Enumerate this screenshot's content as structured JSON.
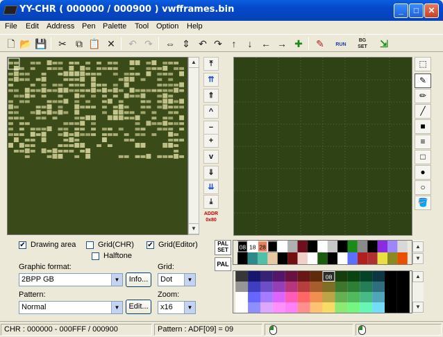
{
  "window": {
    "title": "YY-CHR ( 000000 / 000900 ) vwfframes.bin",
    "minimize": "_",
    "maximize": "□",
    "close": "✕"
  },
  "menu": [
    "File",
    "Edit",
    "Address",
    "Pen",
    "Palette",
    "Tool",
    "Option",
    "Help"
  ],
  "toolbar": {
    "new": "🗋",
    "open": "📂",
    "save": "💾",
    "cut": "✂",
    "copy": "⧉",
    "paste": "📋",
    "delete": "✕",
    "undo": "↶",
    "redo": "↷",
    "flip_h": "⇔",
    "flip_v": "⇕",
    "rot_left": "↶",
    "rot_right": "↷",
    "shift_up": "↑",
    "shift_down": "↓",
    "shift_left": "←",
    "shift_right": "→",
    "replace_color": "✚",
    "edit_icon": "✎",
    "run_label": "RUN",
    "bgset_label": "BG SET",
    "exit_icon": "⇲"
  },
  "nav": {
    "top": "⤒",
    "page_up_fast": "⇈",
    "page_up": "⇑",
    "row_up": "^",
    "line_up": "−",
    "line_down": "+",
    "row_down": "v",
    "page_down": "⇓",
    "page_down_fast": "⇊",
    "bottom": "⤓",
    "addr_label": "ADDR\n0x80"
  },
  "tools": {
    "select": "⬚",
    "pen": "✎",
    "pen2": "✏",
    "line": "╱",
    "rect_fill": "■",
    "stripes": "≡",
    "rect": "□",
    "circle_fill": "●",
    "circle": "○",
    "bucket": "🪣"
  },
  "options": {
    "drawing_area": {
      "label": "Drawing area",
      "checked": true
    },
    "grid_chr": {
      "label": "Grid(CHR)",
      "checked": false
    },
    "grid_editor": {
      "label": "Grid(Editor)",
      "checked": true
    },
    "halftone": {
      "label": "Halftone",
      "checked": false
    }
  },
  "graphic_format": {
    "label": "Graphic format:",
    "value": "2BPP GB",
    "info_button": "Info..."
  },
  "grid": {
    "label": "Grid:",
    "value": "Dot"
  },
  "pattern": {
    "label": "Pattern:",
    "value": "Normal",
    "edit_button": "Edit..."
  },
  "zoom": {
    "label": "Zoom:",
    "value": "x16"
  },
  "palette": {
    "palset_label": "PAL\nSET",
    "pal_label": "PAL",
    "active_indices": [
      "08",
      "18",
      "28",
      "37"
    ],
    "selected_index": "08",
    "top_row": [
      "#000000",
      "#ffffff",
      "#e0805c",
      "#000000",
      "#ffffff",
      "#b0b0b0",
      "#6e0f1e",
      "#000000",
      "#ffffff",
      "#c8c8c8",
      "#000000",
      "#1a8a1a",
      "#8a8a8a",
      "#000000",
      "#8a2be2",
      "#9e86f8",
      "#d8d8d8"
    ],
    "second_row": [
      "#000000",
      "#2c8a8a",
      "#50c0a8",
      "#e8c8a0",
      "#000000",
      "#701010",
      "#f0d0c8",
      "#ffffff",
      "#1c5c10",
      "#000000",
      "#ffffff",
      "#5c70ff",
      "#b02020",
      "#b03030",
      "#e8e040",
      "#8a8a20",
      "#e85000"
    ]
  },
  "status": {
    "chr": "CHR : 000000 - 000FFF / 000900",
    "pattern": "Pattern : ADF[09] = 09"
  },
  "colors": {
    "chr_bg": "#3a4a18",
    "tile": "#c8c890",
    "editor_bg": "#2e4216",
    "editor_grid": "#6a7a3a"
  }
}
